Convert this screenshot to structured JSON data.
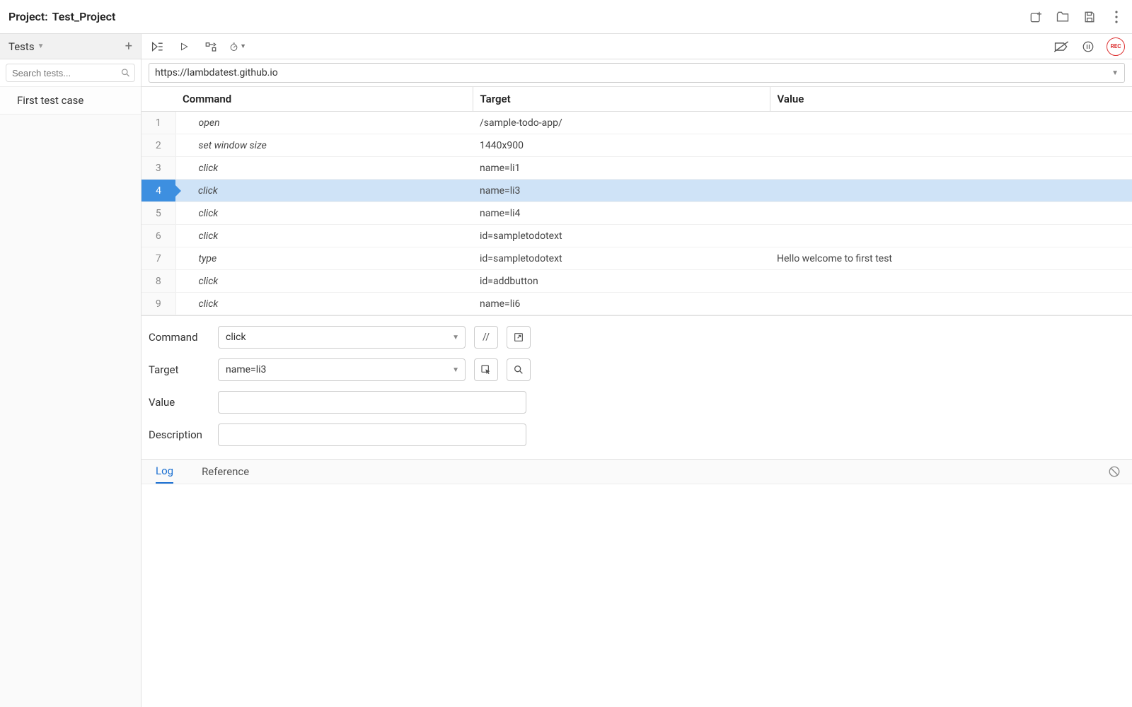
{
  "header": {
    "project_label": "Project:",
    "project_name": "Test_Project"
  },
  "sidebar": {
    "title": "Tests",
    "search_placeholder": "Search tests...",
    "items": [
      {
        "label": "First test case"
      }
    ]
  },
  "url": "https://lambdatest.github.io",
  "columns": {
    "command": "Command",
    "target": "Target",
    "value": "Value"
  },
  "commands": [
    {
      "n": "1",
      "command": "open",
      "target": "/sample-todo-app/",
      "value": ""
    },
    {
      "n": "2",
      "command": "set window size",
      "target": "1440x900",
      "value": ""
    },
    {
      "n": "3",
      "command": "click",
      "target": "name=li1",
      "value": ""
    },
    {
      "n": "4",
      "command": "click",
      "target": "name=li3",
      "value": ""
    },
    {
      "n": "5",
      "command": "click",
      "target": "name=li4",
      "value": ""
    },
    {
      "n": "6",
      "command": "click",
      "target": "id=sampletodotext",
      "value": ""
    },
    {
      "n": "7",
      "command": "type",
      "target": "id=sampletodotext",
      "value": "Hello welcome to first test"
    },
    {
      "n": "8",
      "command": "click",
      "target": "id=addbutton",
      "value": ""
    },
    {
      "n": "9",
      "command": "click",
      "target": "name=li6",
      "value": ""
    }
  ],
  "selected_row_index": 3,
  "editor": {
    "labels": {
      "command": "Command",
      "target": "Target",
      "value": "Value",
      "description": "Description"
    },
    "command": "click",
    "target": "name=li3",
    "value": "",
    "description": "",
    "slash": "//"
  },
  "log": {
    "tabs": {
      "log": "Log",
      "reference": "Reference"
    }
  },
  "rec_label": "REC"
}
